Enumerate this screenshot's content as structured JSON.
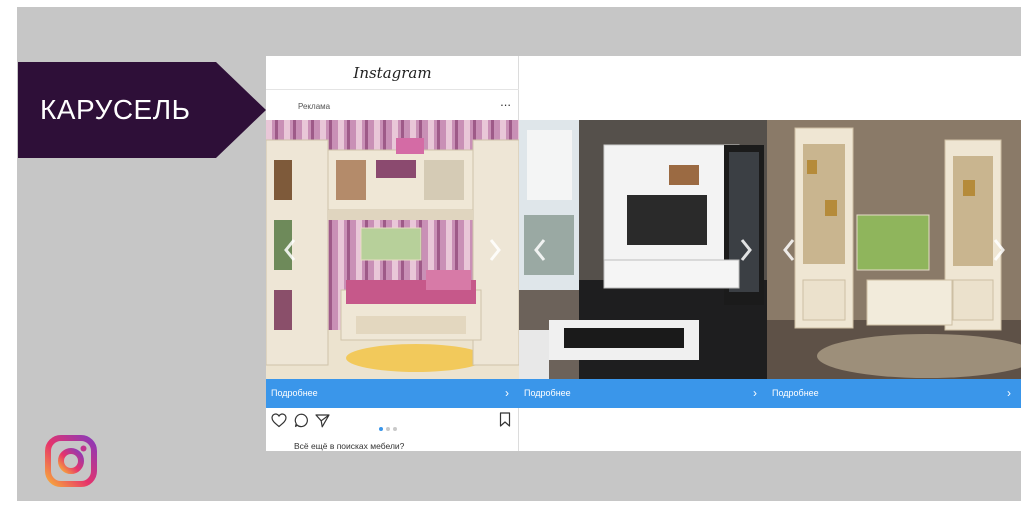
{
  "slide": {
    "banner_title": "КАРУСЕЛЬ"
  },
  "post": {
    "brand_wordmark": "Instagram",
    "ad_label": "Реклама",
    "more_glyph": "...",
    "caption": "Всё ещё в поисках мебели?",
    "carousel_position": 1,
    "carousel_count": 3
  },
  "cards": [
    {
      "cta_label": "Подробнее",
      "chevron": "›",
      "image": "kids-room-wall-unit"
    },
    {
      "cta_label": "Подробнее",
      "chevron": "›",
      "image": "living-room-tv-wall-white-black"
    },
    {
      "cta_label": "Подробнее",
      "chevron": "›",
      "image": "classic-cream-display-cabinets"
    }
  ],
  "colors": {
    "slide_bg": "#c6c6c6",
    "banner_bg": "#2e0f38",
    "cta_blue": "#3a96ea"
  },
  "icons": [
    "heart-icon",
    "comment-icon",
    "share-icon",
    "bookmark-icon",
    "instagram-logo-icon",
    "chevron-left-icon",
    "chevron-right-icon"
  ]
}
